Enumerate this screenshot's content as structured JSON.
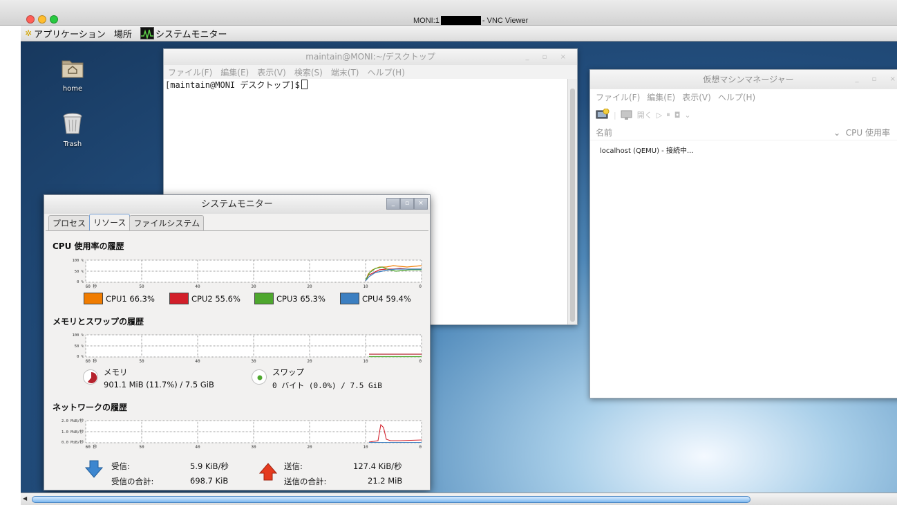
{
  "vnc": {
    "title_prefix": "MONI:1",
    "title_suffix": "- VNC Viewer",
    "dot_colors": [
      "#ff5f57",
      "#ffbd2e",
      "#28c940"
    ]
  },
  "panel": {
    "applications": "アプリケーション",
    "places": "場所",
    "task": "システムモニター"
  },
  "desktop": {
    "icons": [
      {
        "label": "home"
      },
      {
        "label": "Trash"
      }
    ]
  },
  "terminal": {
    "title": "maintain@MONI:~/デスクトップ",
    "menu": [
      "ファイル(F)",
      "編集(E)",
      "表示(V)",
      "検索(S)",
      "端末(T)",
      "ヘルプ(H)"
    ],
    "prompt": "[maintain@MONI デスクトップ]$"
  },
  "vmm": {
    "title": "仮想マシンマネージャー",
    "menu": [
      "ファイル(F)",
      "編集(E)",
      "表示(V)",
      "ヘルプ(H)"
    ],
    "toolbar_open": "開く",
    "col_name": "名前",
    "col_cpu": "CPU 使用率",
    "row": "localhost (QEMU) - 接続中..."
  },
  "sysmon": {
    "title": "システムモニター",
    "tabs": [
      "プロセス",
      "リソース",
      "ファイルシステム"
    ],
    "active_tab": 1,
    "cpu_title": "CPU 使用率の履歴",
    "mem_title": "メモリとスワップの履歴",
    "net_title": "ネットワークの履歴",
    "pct_ticks": [
      "100 %",
      "50 %",
      "0 %"
    ],
    "net_ticks": [
      "2.0 MiB/秒",
      "1.0 MiB/秒",
      "0.0 MiB/秒"
    ],
    "x_ticks": [
      "60 秒",
      "50",
      "40",
      "30",
      "20",
      "10",
      "0"
    ],
    "cpus": [
      {
        "label": "CPU1 66.3%",
        "color": "#f07c00"
      },
      {
        "label": "CPU2 55.6%",
        "color": "#d21f2a"
      },
      {
        "label": "CPU3 65.3%",
        "color": "#4ea72e"
      },
      {
        "label": "CPU4 59.4%",
        "color": "#3c7fc1"
      }
    ],
    "memory_label": "メモリ",
    "memory_value": "901.1 MiB (11.7%) / 7.5 GiB",
    "memory_color": "#b5222d",
    "swap_label": "スワップ",
    "swap_value": "0 バイト (0.0%) / 7.5 GiB",
    "swap_color": "#4ea72e",
    "recv_label": "受信:",
    "recv_value": "5.9 KiB/秒",
    "recv_total_label": "受信の合計:",
    "recv_total_value": "698.7 KiB",
    "send_label": "送信:",
    "send_value": "127.4 KiB/秒",
    "send_total_label": "送信の合計:",
    "send_total_value": "21.2 MiB"
  }
}
